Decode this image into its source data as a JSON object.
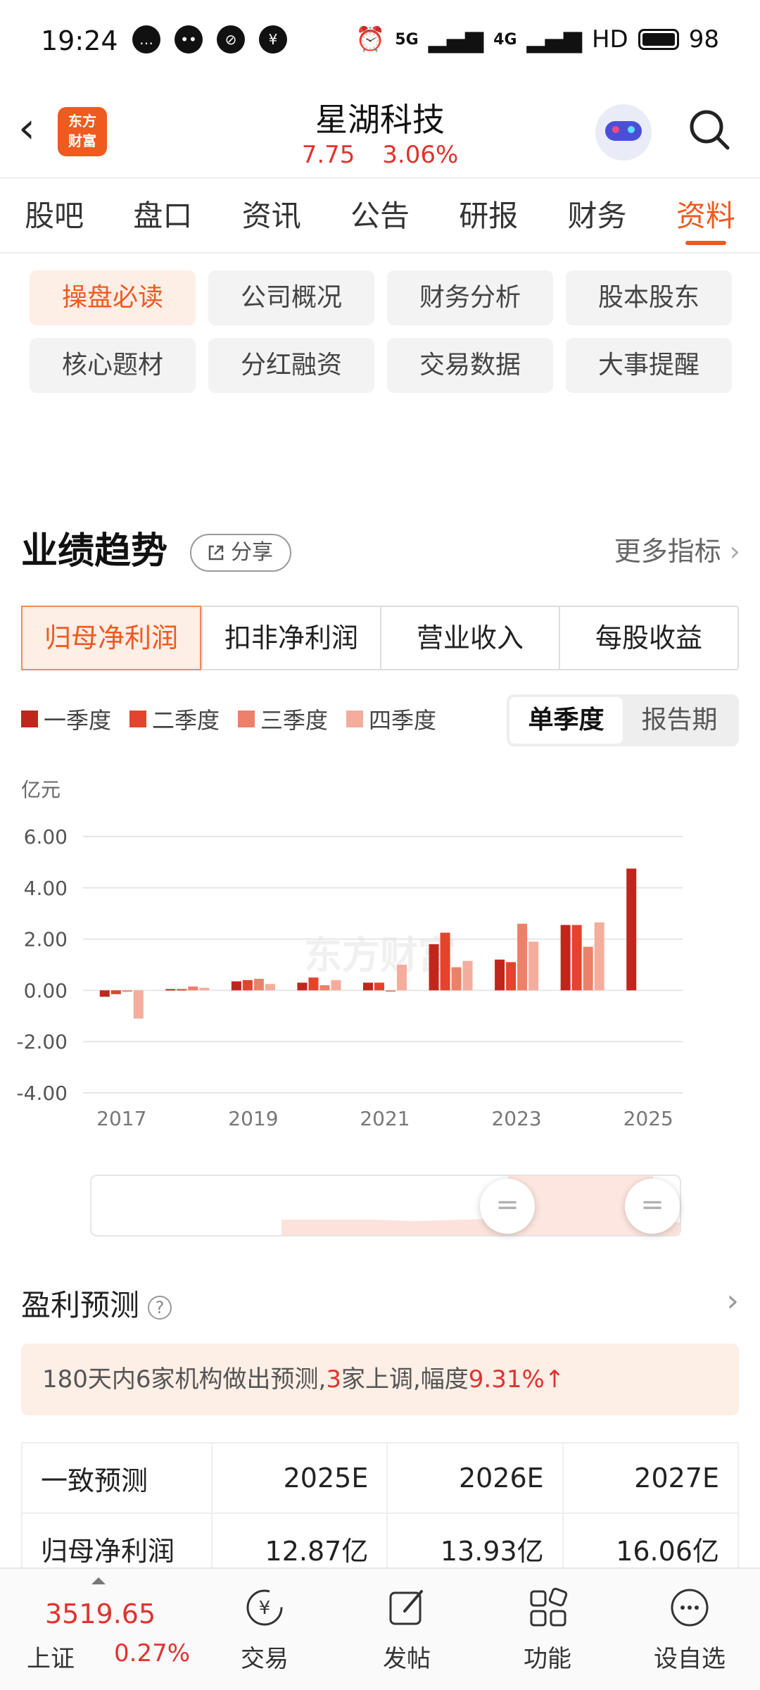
{
  "status": {
    "time": "19:24",
    "net1": "5G",
    "net2": "4G",
    "hd": "HD",
    "battery": "98"
  },
  "header": {
    "logo_line1": "东方",
    "logo_line2": "财富",
    "title": "星湖科技",
    "price": "7.75",
    "change": "3.06%"
  },
  "tabs": [
    "股吧",
    "盘口",
    "资讯",
    "公告",
    "研报",
    "财务",
    "资料"
  ],
  "chips": [
    "操盘必读",
    "公司概况",
    "财务分析",
    "股本股东",
    "核心题材",
    "分红融资",
    "交易数据",
    "大事提醒"
  ],
  "perf": {
    "title": "业绩趋势",
    "share": "分享",
    "more": "更多指标",
    "segments": [
      "归母净利润",
      "扣非净利润",
      "营业收入",
      "每股收益"
    ],
    "legend": [
      "一季度",
      "二季度",
      "三季度",
      "四季度"
    ],
    "toggle": [
      "单季度",
      "报告期"
    ],
    "unit": "亿元",
    "watermark": "东方财富"
  },
  "colors": {
    "accent": "#ef5a1f",
    "q1": "#c0261b",
    "q2": "#e4432c",
    "q3": "#ec8068",
    "q4": "#f4ad9c",
    "up": "#e0332e"
  },
  "chart_data": {
    "type": "bar",
    "title": "",
    "xlabel": "",
    "ylabel": "亿元",
    "ylim": [
      -4,
      6
    ],
    "yticks": [
      "6.00",
      "4.00",
      "2.00",
      "0.00",
      "-2.00",
      "-4.00"
    ],
    "xticks": [
      "2017",
      "2019",
      "2021",
      "2023",
      "2025"
    ],
    "categories": [
      "2017",
      "2018",
      "2019",
      "2020",
      "2021",
      "2022",
      "2023",
      "2024",
      "2025"
    ],
    "series": [
      {
        "name": "一季度",
        "values": [
          -0.25,
          0.05,
          0.35,
          0.3,
          0.3,
          1.8,
          1.2,
          2.55,
          4.75
        ]
      },
      {
        "name": "二季度",
        "values": [
          -0.15,
          0.05,
          0.4,
          0.5,
          0.3,
          2.25,
          1.1,
          2.55,
          null
        ]
      },
      {
        "name": "三季度",
        "values": [
          0.0,
          0.15,
          0.45,
          0.2,
          -0.05,
          0.9,
          2.6,
          1.7,
          null
        ]
      },
      {
        "name": "四季度",
        "values": [
          -1.1,
          0.1,
          0.25,
          0.4,
          1.0,
          1.15,
          1.9,
          2.65,
          null
        ]
      }
    ]
  },
  "forecast": {
    "title": "盈利预测",
    "help": "?",
    "notice_a": "180天内6家机构做出预测,",
    "notice_b": "3",
    "notice_c": "家上调,幅度",
    "notice_d": "9.31%",
    "headers": [
      "一致预测",
      "2025E",
      "2026E",
      "2027E"
    ],
    "row": [
      "归母净利润",
      "12.87亿",
      "13.93亿",
      "16.06亿"
    ]
  },
  "bottom": {
    "index_value": "3519.65",
    "index_name": "上证",
    "index_change": "0.27%",
    "nav": [
      "交易",
      "发帖",
      "功能",
      "设自选"
    ]
  }
}
